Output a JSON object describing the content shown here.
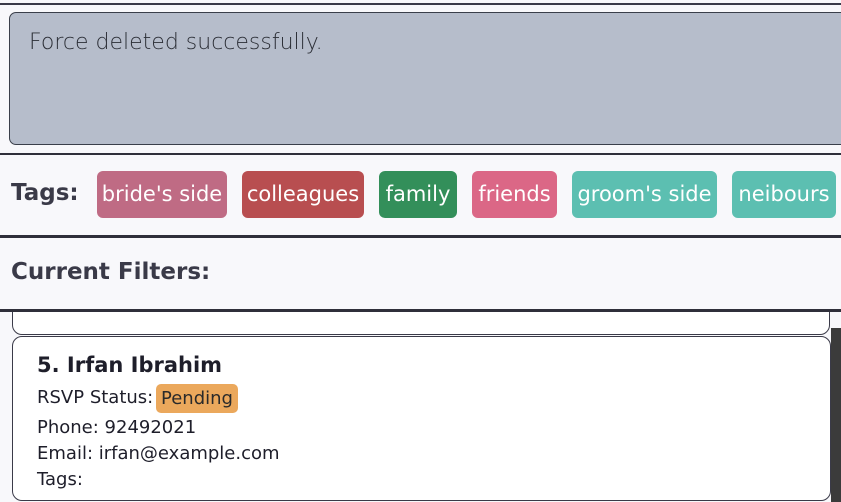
{
  "result_display": {
    "message": "Force deleted successfully."
  },
  "tags_bar": {
    "label": "Tags:",
    "tags": [
      {
        "label": "bride's side",
        "color": "#bf6b84"
      },
      {
        "label": "colleagues",
        "color": "#b84e50"
      },
      {
        "label": "family",
        "color": "#338f5a"
      },
      {
        "label": "friends",
        "color": "#db6786"
      },
      {
        "label": "groom's side",
        "color": "#5cbfb1"
      },
      {
        "label": "neibours",
        "color": "#5cbfb1"
      }
    ]
  },
  "filters_bar": {
    "label": "Current Filters:"
  },
  "guest_card": {
    "name": "5. Irfan Ibrahim",
    "rsvp_label": "RSVP Status:",
    "rsvp_value": "Pending",
    "rsvp_color": "#eba85c",
    "phone": "Phone: 92492021",
    "email": "Email: irfan@example.com",
    "tags_label": "Tags:"
  }
}
